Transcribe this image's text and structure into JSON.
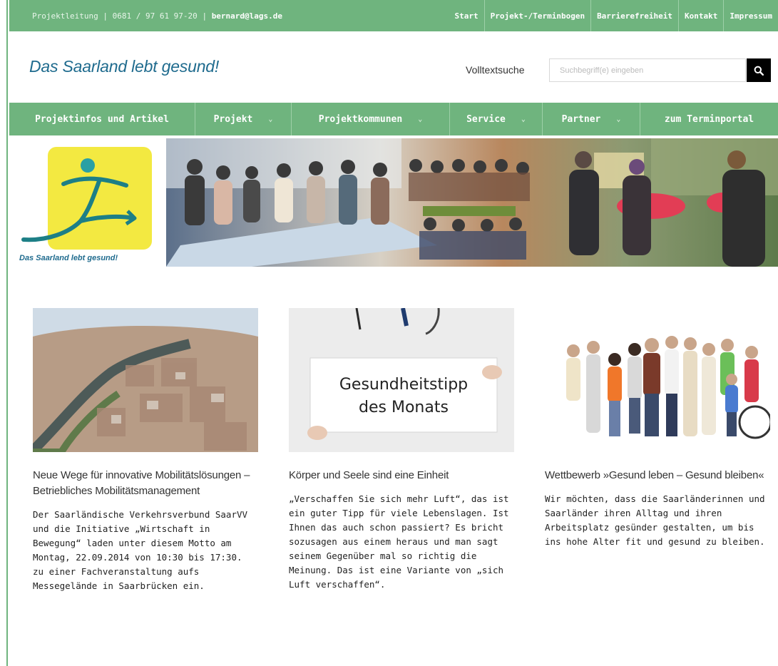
{
  "topbar": {
    "label": "Projektleitung",
    "phone": "0681 / 97 61 97-20",
    "email": "bernard@lags.de",
    "nav": [
      "Start",
      "Projekt-/Terminbogen",
      "Barrierefreiheit",
      "Kontakt",
      "Impressum"
    ]
  },
  "header": {
    "brand": "Das Saarland lebt gesund!",
    "search_label": "Volltextsuche",
    "search_placeholder": "Suchbegriff(e) eingeben"
  },
  "mainnav": {
    "items": [
      {
        "label": "Projektinfos und Artikel",
        "dropdown": false
      },
      {
        "label": "Projekt",
        "dropdown": true
      },
      {
        "label": "Projektkommunen",
        "dropdown": true
      },
      {
        "label": "Service",
        "dropdown": true
      },
      {
        "label": "Partner",
        "dropdown": true
      },
      {
        "label": "zum Terminportal",
        "dropdown": false
      }
    ]
  },
  "hero": {
    "logo_caption": "Das Saarland lebt gesund!"
  },
  "cards": [
    {
      "title": "Neue Wege für innovative Mobilitätslösungen – Betriebliches Mobilitätsmanagement",
      "text": "Der Saarländische Verkehrsverbund SaarVV und die Initiative „Wirtschaft in Bewegung“ laden unter diesem Motto am Montag, 22.09.2014 von 10:30 bis 17:30. zu einer Fachveranstaltung aufs Messegelände in Saarbrücken ein."
    },
    {
      "image_text_line1": "Gesundheitstipp",
      "image_text_line2": "des Monats",
      "title": "Körper und Seele sind eine Einheit",
      "text": "„Verschaffen Sie sich mehr Luft“, das ist ein guter Tipp für viele Lebenslagen. Ist Ihnen das auch schon passiert? Es bricht sozusagen aus einem heraus und man sagt seinem Gegenüber mal so richtig die Meinung. Das ist eine Variante von „sich Luft verschaffen“."
    },
    {
      "title": "Wettbewerb »Gesund leben – Gesund bleiben«",
      "text": "Wir möchten, dass die Saarländerinnen und Saarländer ihren Alltag und ihren Arbeitsplatz gesünder gestalten, um bis ins hohe Alter fit und gesund zu bleiben."
    }
  ],
  "icons": {
    "search": "search-icon",
    "chevron": "chevron-down-icon"
  },
  "colors": {
    "green": "#6fb47e",
    "brand_blue": "#1f6b8e",
    "logo_yellow": "#f3e941"
  }
}
